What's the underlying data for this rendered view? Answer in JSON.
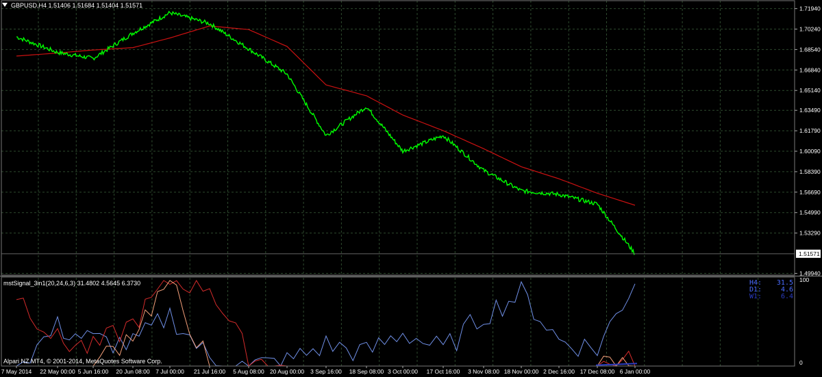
{
  "window": {
    "symbol_title": "GBPUSD,H4  1.51406 1.51684 1.51404 1.51571",
    "indicator_title": "mstSignal_3in1(20,24,6,3) 31.4802 4.5645 6.3730",
    "copyright": "Alpari NZ MT4, © 2001-2014, MetaQuotes Software Corp."
  },
  "timeframe_readout": [
    {
      "tf": "H4",
      "value": "31.5"
    },
    {
      "tf": "D1",
      "value": "4.6"
    },
    {
      "tf": "W1",
      "value": "6.4"
    }
  ],
  "colors": {
    "background": "#000000",
    "price_line": "#00ff00",
    "moving_average": "#cc1111",
    "grid": "#2e4a2e",
    "axis_text": "#ffffff",
    "current_price_box": "#ffffff",
    "indicator_red": "#d42b2b",
    "indicator_salmon": "#f4a07a",
    "indicator_blue": "#7090e8",
    "indicator_navy": "#2a3cc0"
  },
  "chart_data": [
    {
      "type": "line",
      "title": "GBPUSD,H4",
      "ylim": [
        1.498,
        1.726
      ],
      "y_ticks": [
        "1.71940",
        "1.70240",
        "1.68540",
        "1.66840",
        "1.65140",
        "1.63490",
        "1.61790",
        "1.60090",
        "1.58390",
        "1.56690",
        "1.54990",
        "1.53290",
        "1.49940"
      ],
      "current_price": "1.51571",
      "x_ticks": [
        "7 May 2014",
        "22 May 00:00",
        "5 Jun 16:00",
        "20 Jun 08:00",
        "7 Jul 00:00",
        "21 Jul 16:00",
        "5 Aug 08:00",
        "20 Aug 00:00",
        "3 Sep 16:00",
        "18 Sep 08:00",
        "3 Oct 00:00",
        "17 Oct 16:00",
        "3 Nov 08:00",
        "18 Nov 00:00",
        "2 Dec 16:00",
        "17 Dec 08:00",
        "6 Jan 00:00"
      ],
      "x": [
        "7 May",
        "22 May",
        "5 Jun",
        "20 Jun",
        "7 Jul",
        "21 Jul",
        "5 Aug",
        "20 Aug",
        "3 Sep",
        "18 Sep",
        "3 Oct",
        "17 Oct",
        "3 Nov",
        "18 Nov",
        "2 Dec",
        "17 Dec",
        "6 Jan"
      ],
      "series": [
        {
          "name": "GBPUSD",
          "values": [
            1.696,
            1.683,
            1.678,
            1.699,
            1.716,
            1.707,
            1.686,
            1.665,
            1.614,
            1.638,
            1.601,
            1.614,
            1.585,
            1.568,
            1.565,
            1.557,
            1.5157
          ]
        },
        {
          "name": "MA",
          "values": [
            1.68,
            1.6825,
            1.685,
            1.687,
            1.695,
            1.705,
            1.702,
            1.688,
            1.656,
            1.647,
            1.631,
            1.618,
            1.603,
            1.588,
            1.578,
            1.566,
            1.556
          ]
        }
      ]
    },
    {
      "type": "line",
      "title": "mstSignal_3in1(20,24,6,3)",
      "ylim": [
        0,
        100
      ],
      "y_ticks": [
        "100",
        "0"
      ],
      "series": [
        {
          "name": "H4",
          "values": [
            0,
            45,
            30,
            25,
            60,
            8,
            0,
            5,
            25,
            15,
            40,
            18,
            60,
            85,
            30,
            20,
            100
          ]
        },
        {
          "name": "D1",
          "values": [
            85,
            30,
            20,
            50,
            100,
            95,
            10,
            0,
            0,
            0,
            0,
            0,
            0,
            0,
            0,
            0,
            5
          ]
        },
        {
          "name": "W1",
          "values": [
            0,
            0,
            0,
            40,
            100,
            0,
            0,
            0,
            0,
            0,
            0,
            0,
            0,
            0,
            0,
            0,
            2
          ]
        }
      ]
    }
  ]
}
